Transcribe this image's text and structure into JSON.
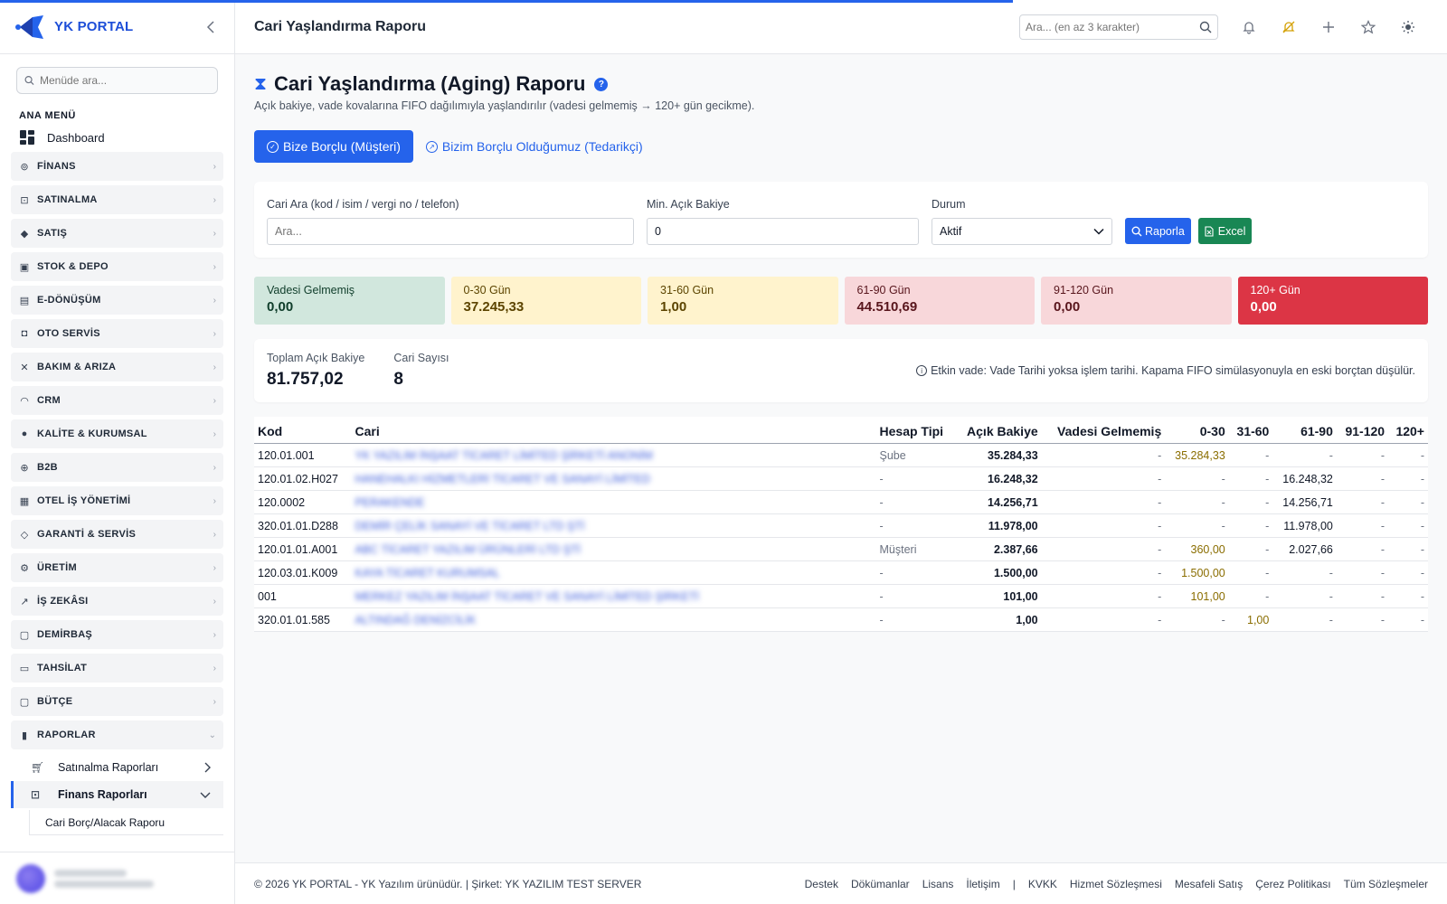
{
  "brand": {
    "name": "YK PORTAL"
  },
  "progress": {
    "loaded_fraction": 0.7
  },
  "sidebar": {
    "search_placeholder": "Menüde ara...",
    "section_title": "ANA MENÜ",
    "dashboard_label": "Dashboard",
    "groups": [
      "FİNANS",
      "SATINALMA",
      "SATIŞ",
      "STOK & DEPO",
      "E-DÖNÜŞÜM",
      "OTO SERVİS",
      "BAKIM & ARIZA",
      "CRM",
      "KALİTE & KURUMSAL",
      "B2B",
      "OTEL İŞ YÖNETİMİ",
      "GARANTİ & SERVİS",
      "ÜRETİM",
      "İŞ ZEKÂSI",
      "DEMİRBAŞ",
      "TAHSİLAT",
      "BÜTÇE",
      "RAPORLAR"
    ],
    "sub_items": [
      "Satınalma Raporları",
      "Finans Raporları"
    ],
    "sub_sub_items": [
      "Cari Borç/Alacak Raporu"
    ]
  },
  "header": {
    "title": "Cari Yaşlandırma Raporu",
    "search_placeholder": "Ara... (en az 3 karakter)"
  },
  "page": {
    "title": "Cari Yaşlandırma (Aging) Raporu",
    "help": "?",
    "subtitle": "Açık bakiye, vade kovalarına FIFO dağılımıyla yaşlandırılır (vadesi gelmemiş → 120+ gün gecikme).",
    "tabs": [
      "Bize Borçlu (Müşteri)",
      "Bizim Borçlu Olduğumuz (Tedarikçi)"
    ]
  },
  "filters": {
    "search_label": "Cari Ara (kod / isim / vergi no / telefon)",
    "search_placeholder": "Ara...",
    "min_label": "Min. Açık Bakiye",
    "min_value": "0",
    "status_label": "Durum",
    "status_value": "Aktif",
    "report_button": "Raporla",
    "excel_button": "Excel"
  },
  "buckets": [
    {
      "label": "Vadesi Gelmemiş",
      "value": "0,00"
    },
    {
      "label": "0-30 Gün",
      "value": "37.245,33"
    },
    {
      "label": "31-60 Gün",
      "value": "1,00"
    },
    {
      "label": "61-90 Gün",
      "value": "44.510,69"
    },
    {
      "label": "91-120 Gün",
      "value": "0,00"
    },
    {
      "label": "120+ Gün",
      "value": "0,00"
    }
  ],
  "colors": {
    "accent": "#2563eb",
    "bucket_bg": [
      "#d1e7dd",
      "#fff3cd",
      "#fff3cd",
      "#f8d7da",
      "#f8d7da",
      "#dc3545"
    ],
    "bucket_fg": [
      "#0f3d2a",
      "#5c4400",
      "#5c4400",
      "#58151c",
      "#58151c",
      "#ffffff"
    ]
  },
  "summary": {
    "total_label": "Toplam Açık Bakiye",
    "total_value": "81.757,02",
    "count_label": "Cari Sayısı",
    "count_value": "8",
    "note": "Etkin vade: Vade Tarihi yoksa işlem tarihi. Kapama FIFO simülasyonuyla en eski borçtan düşülür."
  },
  "table": {
    "headers": [
      "Kod",
      "Cari",
      "Hesap Tipi",
      "Açık Bakiye",
      "Vadesi Gelmemiş",
      "0-30",
      "31-60",
      "61-90",
      "91-120",
      "120+"
    ],
    "rows": [
      [
        "120.01.001",
        "YK YAZILIM İNŞAAT TİCARET LİMİTED ŞİRKETİ ANONİM",
        "Şube",
        "35.284,33",
        "-",
        "35.284,33",
        "-",
        "-",
        "-",
        "-"
      ],
      [
        "120.01.02.H027",
        "HANEHALKI HİZMETLERİ TİCARET VE SANAYİ LİMİTED",
        "-",
        "16.248,32",
        "-",
        "-",
        "-",
        "16.248,32",
        "-",
        "-"
      ],
      [
        "120.0002",
        "PERAKENDE",
        "-",
        "14.256,71",
        "-",
        "-",
        "-",
        "14.256,71",
        "-",
        "-"
      ],
      [
        "320.01.01.D288",
        "DEMİR ÇELİK SANAYİ VE TİCARET LTD ŞTİ",
        "-",
        "11.978,00",
        "-",
        "-",
        "-",
        "11.978,00",
        "-",
        "-"
      ],
      [
        "120.01.01.A001",
        "ABC TİCARET YAZILIM ÜRÜNLERİ LTD ŞTİ",
        "Müşteri",
        "2.387,66",
        "-",
        "360,00",
        "-",
        "2.027,66",
        "-",
        "-"
      ],
      [
        "120.03.01.K009",
        "KAYA TİCARET KURUMSAL",
        "-",
        "1.500,00",
        "-",
        "1.500,00",
        "-",
        "-",
        "-",
        "-"
      ],
      [
        "001",
        "MERKEZ YAZILIM İNŞAAT TİCARET VE SANAYİ LİMİTED ŞİRKETİ",
        "-",
        "101,00",
        "-",
        "101,00",
        "-",
        "-",
        "-",
        "-"
      ],
      [
        "320.01.01.585",
        "ALTINDAĞ DENİZCİLİK",
        "-",
        "1,00",
        "-",
        "-",
        "1,00",
        "-",
        "-",
        "-"
      ]
    ]
  },
  "footer": {
    "left": "© 2026 YK PORTAL - YK Yazılım ürünüdür. | Şirket: YK YAZILIM TEST SERVER",
    "links": [
      "Destek",
      "Dökümanlar",
      "Lisans",
      "İletişim",
      "|",
      "KVKK",
      "Hizmet Sözleşmesi",
      "Mesafeli Satış",
      "Çerez Politikası",
      "Tüm Sözleşmeler"
    ]
  }
}
